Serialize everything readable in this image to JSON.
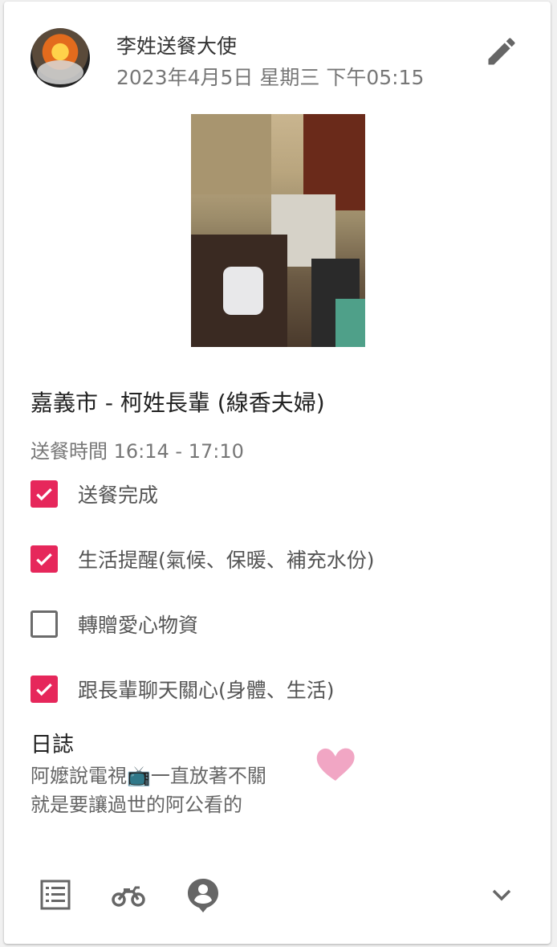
{
  "post": {
    "author": "李姓送餐大使",
    "date": "2023年4月5日 星期三 下午05:15",
    "title": "嘉義市 - 柯姓長輩 (線香夫婦)",
    "delivery_time": "送餐時間 16:14 - 17:10"
  },
  "checklist": [
    {
      "label": "送餐完成",
      "checked": true
    },
    {
      "label": "生活提醒(氣候、保暖、補充水份)",
      "checked": true
    },
    {
      "label": "轉贈愛心物資",
      "checked": false
    },
    {
      "label": "跟長輩聊天關心(身體、生活)",
      "checked": true
    }
  ],
  "log": {
    "title": "日誌",
    "line1": "阿嬤說電視📺一直放著不關",
    "line2": "就是要讓過世的阿公看的"
  },
  "colors": {
    "accent": "#e6275b",
    "heart": "#f1a6c4",
    "icon": "#666666"
  },
  "icons": {
    "edit": "pencil-icon",
    "list": "list-icon",
    "bike": "motorcycle-icon",
    "person": "person-pin-icon",
    "expand": "chevron-down-icon"
  }
}
